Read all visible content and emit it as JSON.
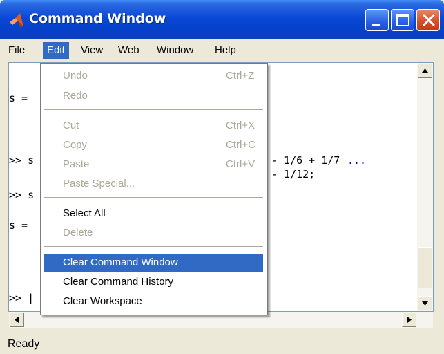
{
  "window": {
    "title": "Command Window"
  },
  "menubar": {
    "items": [
      {
        "label": "File"
      },
      {
        "label": "Edit"
      },
      {
        "label": "View"
      },
      {
        "label": "Web"
      },
      {
        "label": "Window"
      },
      {
        "label": "Help"
      }
    ]
  },
  "content": {
    "lines": [
      {
        "text": "s ="
      },
      {
        "text": ">> s"
      },
      {
        "text": "- 1/6 + 1/7"
      },
      {
        "text": "..."
      },
      {
        "text": ">> s"
      },
      {
        "text": "- 1/12;"
      },
      {
        "text": "s ="
      },
      {
        "text": ">> |"
      }
    ]
  },
  "edit_menu": {
    "items": [
      {
        "label": "Undo",
        "shortcut": "Ctrl+Z",
        "enabled": false
      },
      {
        "label": "Redo",
        "shortcut": "",
        "enabled": false
      },
      {
        "label": "Cut",
        "shortcut": "Ctrl+X",
        "enabled": false
      },
      {
        "label": "Copy",
        "shortcut": "Ctrl+C",
        "enabled": false
      },
      {
        "label": "Paste",
        "shortcut": "Ctrl+V",
        "enabled": false
      },
      {
        "label": "Paste Special...",
        "shortcut": "",
        "enabled": false
      },
      {
        "label": "Select All",
        "shortcut": "",
        "enabled": true
      },
      {
        "label": "Delete",
        "shortcut": "",
        "enabled": false
      },
      {
        "label": "Clear Command Window",
        "shortcut": "",
        "enabled": true,
        "highlighted": true
      },
      {
        "label": "Clear Command History",
        "shortcut": "",
        "enabled": true
      },
      {
        "label": "Clear Workspace",
        "shortcut": "",
        "enabled": true
      }
    ]
  },
  "status": {
    "text": "Ready"
  },
  "colors": {
    "titlebar": "#0a49d6",
    "menu_highlight": "#316ac5",
    "disabled_text": "#aca899",
    "continuation": "#0000ff"
  }
}
